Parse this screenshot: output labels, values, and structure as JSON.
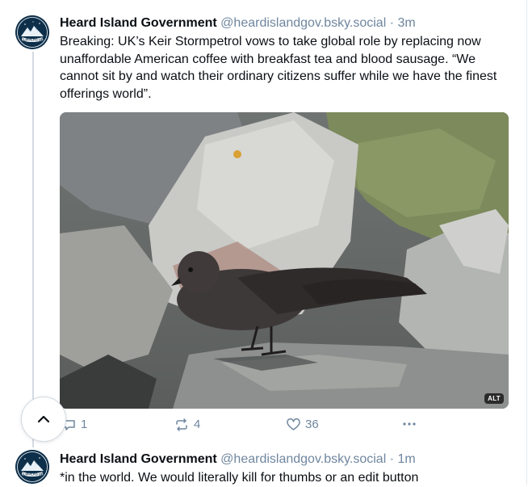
{
  "posts": [
    {
      "author_name": "Heard Island Government",
      "handle": "@heardislandgov.bsky.social",
      "separator": "·",
      "time": "3m",
      "avatar_label": "FLIPPERS UP",
      "text": "Breaking: UK’s Keir Stormpetrol vows to take global role by replacing now unaffordable American coffee with breakfast tea and blood sausage. “We cannot sit by and watch their ordinary citizens suffer while we have the finest offerings world”.",
      "image": {
        "alt_badge": "ALT"
      },
      "actions": {
        "reply_count": "1",
        "repost_count": "4",
        "like_count": "36",
        "more_icon": "ellipsis-icon"
      }
    },
    {
      "author_name": "Heard Island Government",
      "handle": "@heardislandgov.bsky.social",
      "separator": "·",
      "time": "1m",
      "avatar_label": "FLIPPERS UP",
      "text": "*in the world. We would literally kill for thumbs or an edit button"
    }
  ],
  "scroll_top_icon": "chevron-up-icon",
  "colors": {
    "muted": "#6f869f",
    "text": "#0b0f14",
    "divider": "#e3e8ee"
  }
}
